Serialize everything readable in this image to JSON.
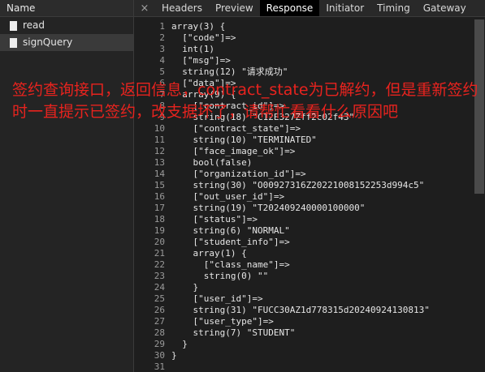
{
  "left_panel": {
    "header": "Name",
    "requests": [
      {
        "name": "read",
        "selected": false
      },
      {
        "name": "signQuery",
        "selected": true
      }
    ]
  },
  "tabs": {
    "close_glyph": "×",
    "items": [
      {
        "label": "Headers",
        "active": false
      },
      {
        "label": "Preview",
        "active": false
      },
      {
        "label": "Response",
        "active": true
      },
      {
        "label": "Initiator",
        "active": false
      },
      {
        "label": "Timing",
        "active": false
      },
      {
        "label": "Gateway",
        "active": false
      }
    ]
  },
  "response_lines": [
    {
      "n": "1",
      "text": "array(3) {"
    },
    {
      "n": "2",
      "text": "  [\"code\"]=>"
    },
    {
      "n": "3",
      "text": "  int(1)"
    },
    {
      "n": "4",
      "text": "  [\"msg\"]=>"
    },
    {
      "n": "5",
      "text": "  string(12) \"请求成功\""
    },
    {
      "n": "6",
      "text": "  [\"data\"]=>"
    },
    {
      "n": "7",
      "text": "  array(9) {"
    },
    {
      "n": "8",
      "text": "    [\"contract_id\"]=>"
    },
    {
      "n": "9",
      "text": "    string(18) \"C12E327Zff2c02f43\""
    },
    {
      "n": "10",
      "text": "    [\"contract_state\"]=>"
    },
    {
      "n": "11",
      "text": "    string(10) \"TERMINATED\""
    },
    {
      "n": "12",
      "text": "    [\"face_image_ok\"]=>"
    },
    {
      "n": "13",
      "text": "    bool(false)"
    },
    {
      "n": "14",
      "text": "    [\"organization_id\"]=>"
    },
    {
      "n": "15",
      "text": "    string(30) \"O00927316Z20221008152253d994c5\""
    },
    {
      "n": "16",
      "text": "    [\"out_user_id\"]=>"
    },
    {
      "n": "17",
      "text": "    string(19) \"T202409240000100000\""
    },
    {
      "n": "18",
      "text": "    [\"status\"]=>"
    },
    {
      "n": "19",
      "text": "    string(6) \"NORMAL\""
    },
    {
      "n": "20",
      "text": "    [\"student_info\"]=>"
    },
    {
      "n": "21",
      "text": "    array(1) {"
    },
    {
      "n": "22",
      "text": "      [\"class_name\"]=>"
    },
    {
      "n": "23",
      "text": "      string(0) \"\""
    },
    {
      "n": "24",
      "text": "    }"
    },
    {
      "n": "25",
      "text": "    [\"user_id\"]=>"
    },
    {
      "n": "26",
      "text": "    string(31) \"FUCC30AZ1d778315d20240924130813\""
    },
    {
      "n": "27",
      "text": "    [\"user_type\"]=>"
    },
    {
      "n": "28",
      "text": "    string(7) \"STUDENT\""
    },
    {
      "n": "29",
      "text": "  }"
    },
    {
      "n": "30",
      "text": "}"
    },
    {
      "n": "31",
      "text": ""
    }
  ],
  "annotation": "签约查询接口，返回信息，contract_state为已解约，但是重新签约时一直提示已签约，改支据坏了，请帮忙看看什么原因吧",
  "colors": {
    "annotation": "#e8231e",
    "active_tab_bg": "#000000",
    "selected_row_bg": "#3a3a3a"
  }
}
